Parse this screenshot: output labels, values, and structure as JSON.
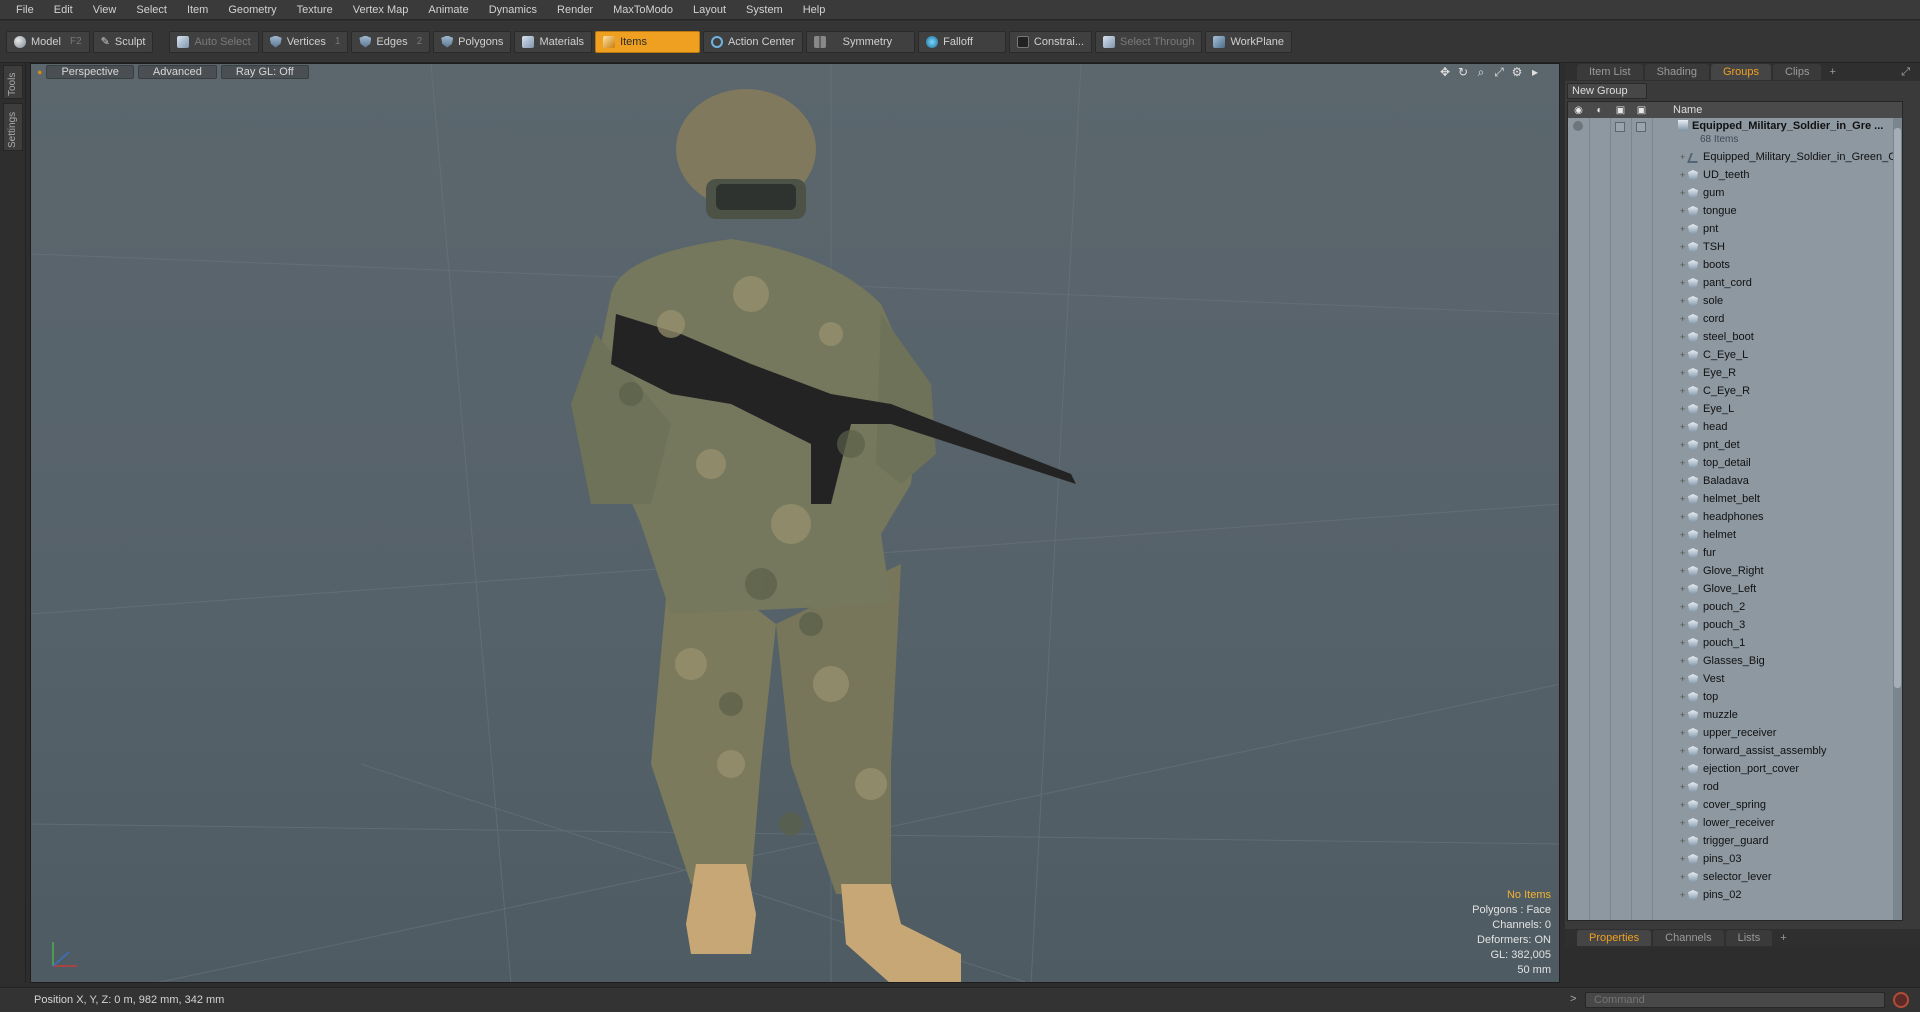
{
  "menu": [
    "File",
    "Edit",
    "View",
    "Select",
    "Item",
    "Geometry",
    "Texture",
    "Vertex Map",
    "Animate",
    "Dynamics",
    "Render",
    "MaxToModo",
    "Layout",
    "System",
    "Help"
  ],
  "toolbar": {
    "model": {
      "label": "Model",
      "key": "F2"
    },
    "sculpt": {
      "label": "Sculpt"
    },
    "auto_select": {
      "label": "Auto Select"
    },
    "vertices": {
      "label": "Vertices",
      "key": "1"
    },
    "edges": {
      "label": "Edges",
      "key": "2"
    },
    "polygons": {
      "label": "Polygons"
    },
    "materials": {
      "label": "Materials"
    },
    "items": {
      "label": "Items"
    },
    "action_center": {
      "label": "Action Center"
    },
    "symmetry": {
      "label": "Symmetry"
    },
    "falloff": {
      "label": "Falloff"
    },
    "constraints": {
      "label": "Constrai..."
    },
    "select_through": {
      "label": "Select Through"
    },
    "workplane": {
      "label": "WorkPlane"
    }
  },
  "left_tabs": [
    "Tools",
    "Settings"
  ],
  "viewport": {
    "buttons": [
      "Perspective",
      "Advanced",
      "Ray GL: Off"
    ],
    "info": {
      "selection": "No Items",
      "polygons": "Polygons : Face",
      "channels": "Channels: 0",
      "deformers": "Deformers: ON",
      "gl": "GL: 382,005",
      "scale": "50 mm"
    }
  },
  "right_panel": {
    "tabs": [
      "Item List",
      "Shading",
      "Groups",
      "Clips"
    ],
    "active_tab": "Groups",
    "new_group": "New Group",
    "column_name": "Name",
    "group": {
      "name": "Equipped_Military_Soldier_in_Gre ...",
      "count": "68 Items"
    },
    "items": [
      "Equipped_Military_Soldier_in_Green_C...",
      "UD_teeth",
      "gum",
      "tongue",
      "pnt",
      "TSH",
      "boots",
      "pant_cord",
      "sole",
      "cord",
      "steel_boot",
      "C_Eye_L",
      "Eye_R",
      "C_Eye_R",
      "Eye_L",
      "head",
      "pnt_det",
      "top_detail",
      "Baladava",
      "helmet_belt",
      "headphones",
      "helmet",
      "fur",
      "Glove_Right",
      "Glove_Left",
      "pouch_2",
      "pouch_3",
      "pouch_1",
      "Glasses_Big",
      "Vest",
      "top",
      "muzzle",
      "upper_receiver",
      "forward_assist_assembly",
      "ejection_port_cover",
      "rod",
      "cover_spring",
      "lower_receiver",
      "trigger_guard",
      "pins_03",
      "selector_lever",
      "pins_02"
    ],
    "bottom_tabs": [
      "Properties",
      "Channels",
      "Lists"
    ]
  },
  "status": {
    "position": "Position X, Y, Z:   0 m, 982 mm, 342 mm",
    "command_placeholder": "Command"
  },
  "colors": {
    "accent": "#f0a020",
    "viewport_bg": "#56626a"
  }
}
